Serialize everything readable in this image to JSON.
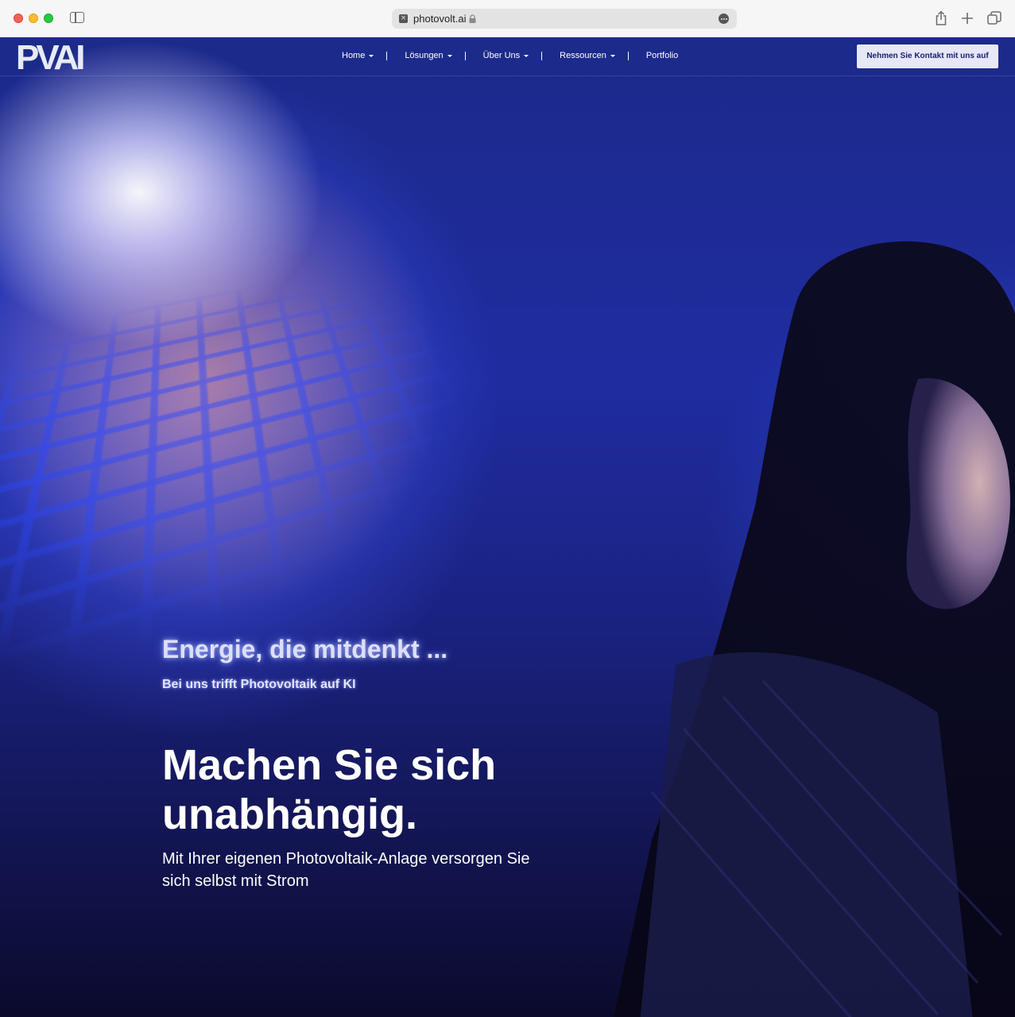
{
  "browser": {
    "url": "photovolt.ai"
  },
  "nav": {
    "logo": "PVAI",
    "items": [
      {
        "label": "Home",
        "has_dropdown": true
      },
      {
        "label": "Lösungen",
        "has_dropdown": true
      },
      {
        "label": "Über Uns",
        "has_dropdown": true
      },
      {
        "label": "Ressourcen",
        "has_dropdown": true
      },
      {
        "label": "Portfolio",
        "has_dropdown": false
      }
    ],
    "cta_label": "Nehmen Sie Kontakt mit uns auf"
  },
  "hero": {
    "tagline": "Energie, die mitdenkt ...",
    "subtagline": "Bei uns trifft Photovoltaik auf KI",
    "headline": "Machen Sie sich unabhängig.",
    "subheadline": "Mit Ihrer eigenen Photovoltaik-Anlage versorgen Sie sich selbst mit Strom"
  },
  "colors": {
    "brand_dark": "#1a1d6e",
    "hero_blue": "#1f2ca0",
    "cta_bg": "#e6e7f7"
  },
  "icons": [
    "sidebar-icon",
    "lock-icon",
    "more-icon",
    "share-icon",
    "plus-icon",
    "tabs-icon",
    "chevron-down-icon"
  ]
}
